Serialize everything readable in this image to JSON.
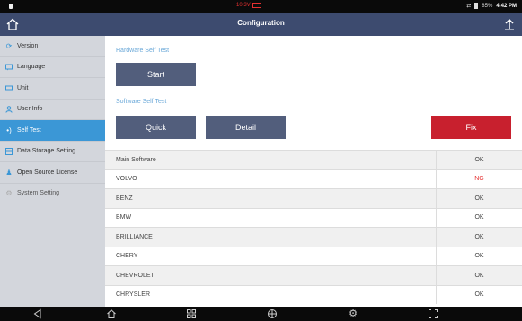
{
  "status_bar": {
    "voltage": "10.3V",
    "battery_text": "85%",
    "time": "4:42 PM"
  },
  "header": {
    "title": "Configuration"
  },
  "sidebar": {
    "items": [
      {
        "label": "Version",
        "icon": "refresh-icon"
      },
      {
        "label": "Language",
        "icon": "language-icon"
      },
      {
        "label": "Unit",
        "icon": "unit-icon"
      },
      {
        "label": "User Info",
        "icon": "user-icon"
      },
      {
        "label": "Self Test",
        "icon": "self-test-icon",
        "active": true
      },
      {
        "label": "Data Storage Setting",
        "icon": "storage-icon"
      },
      {
        "label": "Open Source License",
        "icon": "license-icon"
      },
      {
        "label": "System Setting",
        "icon": "system-setting-icon",
        "dim": true
      }
    ]
  },
  "main": {
    "hardware_label": "Hardware Self Test",
    "start_label": "Start",
    "software_label": "Software Self Test",
    "quick_label": "Quick",
    "detail_label": "Detail",
    "fix_label": "Fix",
    "rows": [
      {
        "name": "Main Software",
        "status": "OK"
      },
      {
        "name": "VOLVO",
        "status": "NG"
      },
      {
        "name": "BENZ",
        "status": "OK"
      },
      {
        "name": "BMW",
        "status": "OK"
      },
      {
        "name": "BRILLIANCE",
        "status": "OK"
      },
      {
        "name": "CHERY",
        "status": "OK"
      },
      {
        "name": "CHEVROLET",
        "status": "OK"
      },
      {
        "name": "CHRYSLER",
        "status": "OK"
      }
    ]
  },
  "colors": {
    "title_bar": "#3d4b6f",
    "sidebar_active": "#3b97d6",
    "button_dark": "#525e7c",
    "button_fix": "#c8202e",
    "status_ng": "#e53030"
  }
}
